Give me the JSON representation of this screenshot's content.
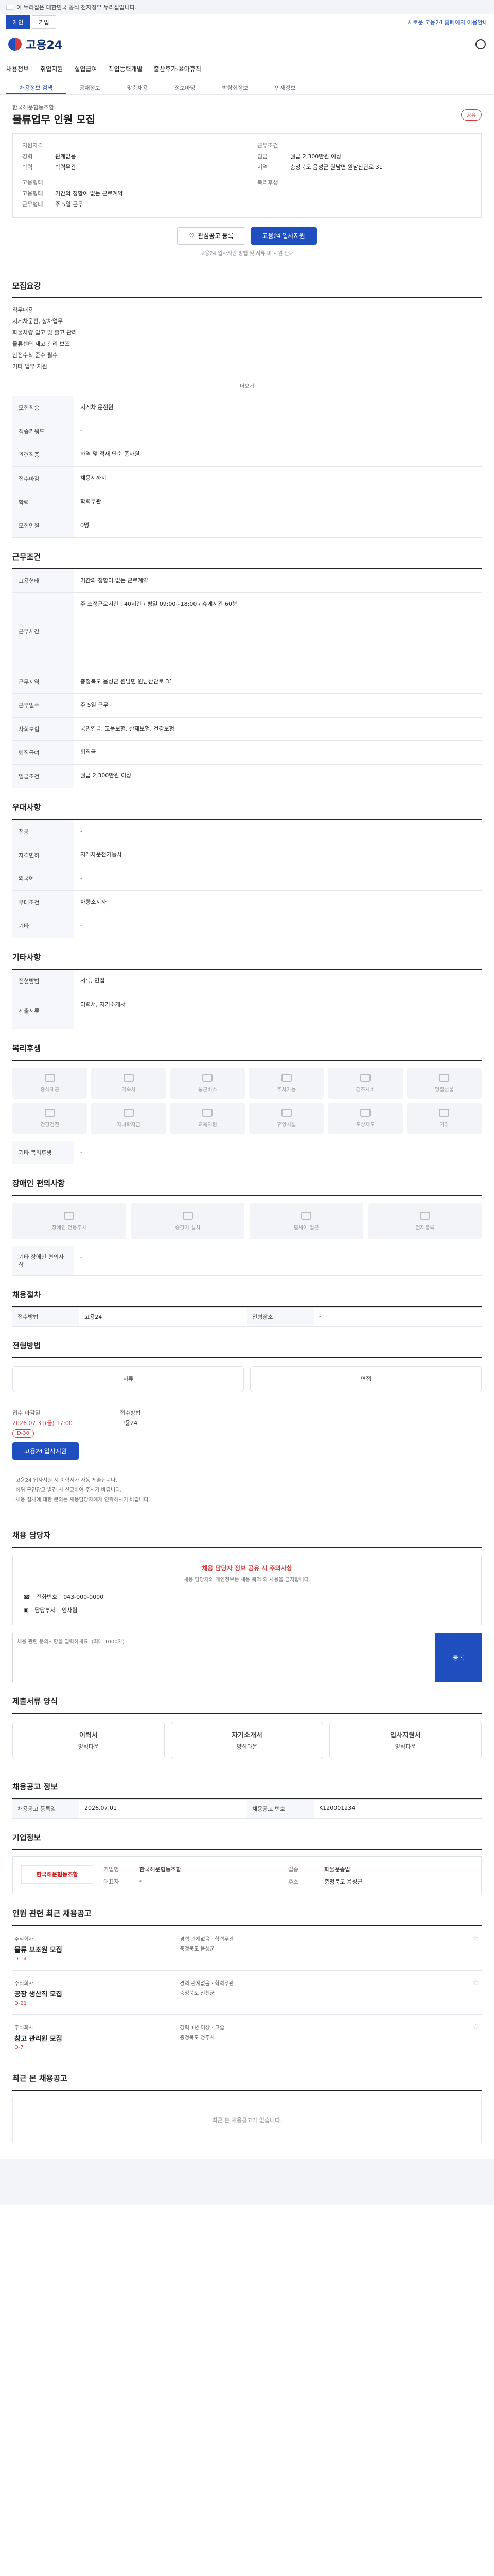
{
  "banner": {
    "text": "이 누리집은 대한민국 공식 전자정부 누리집입니다."
  },
  "utility": {
    "tab_individual": "개인",
    "tab_company": "기업",
    "right": "새로운 고용24 홈페이지 이용안내"
  },
  "logo": {
    "text": "고용24"
  },
  "nav": [
    "채용정보",
    "취업지원",
    "실업급여",
    "직업능력개발",
    "출산휴가·육아휴직"
  ],
  "subnav": [
    "채용정보 검색",
    "공채정보",
    "맞춤채용",
    "정보마당",
    "박람회정보",
    "인재정보"
  ],
  "job": {
    "company": "한국해운협동조합",
    "title": "물류업무 인원 모집",
    "share": "공유",
    "summary_left_title": "지원자격",
    "summary_right_title": "근무조건",
    "left": [
      {
        "k": "경력",
        "v": "관계없음"
      },
      {
        "k": "학력",
        "v": "학력무관"
      }
    ],
    "right": [
      {
        "k": "임금",
        "v": "월급 2,300만원 이상"
      },
      {
        "k": "지역",
        "v": "충청북도 음성군 원남면 원남산단로 31"
      }
    ],
    "left2_title": "고용형태",
    "left2": [
      {
        "k": "고용형태",
        "v": "기간의 정함이 없는 근로계약"
      },
      {
        "k": "근무형태",
        "v": "주 5일 근무"
      }
    ],
    "right2_title": "복리후생",
    "btn_scrap": "관심공고 등록",
    "btn_apply": "고용24 입사지원",
    "note": "고용24 입사지원 방법 및 서류 미 지원 안내"
  },
  "recruit": {
    "title": "모집요강",
    "lines": [
      "직무내용",
      "지게차운전, 상차업무",
      "화물차량 입고 및 출고 관리",
      "물류센터 재고 관리 보조",
      "안전수칙 준수 필수",
      "기타 업무 지원"
    ],
    "more": "더보기",
    "rows": [
      {
        "k": "모집직종",
        "v": "지게차 운전원"
      },
      {
        "k": "직종키워드",
        "v": "-"
      },
      {
        "k": "관련직종",
        "v": "하역 및 적재 단순 종사원"
      },
      {
        "k": "접수마감",
        "v": "채용시까지"
      },
      {
        "k": "학력",
        "v": "학력무관"
      },
      {
        "k": "모집인원",
        "v": "0명"
      }
    ]
  },
  "conditions": {
    "title": "근무조건",
    "rows": [
      {
        "k": "고용형태",
        "v": "기간의 정함이 없는 근로계약"
      },
      {
        "k": "근무시간",
        "v": "주 소정근로시간 : 40시간 / 평일 09:00~18:00 / 휴게시간 60분"
      },
      {
        "k": "근무지역",
        "v": "충청북도 음성군 원남면 원남산단로 31"
      },
      {
        "k": "근무일수",
        "v": "주 5일 근무"
      },
      {
        "k": "사회보험",
        "v": "국민연금, 고용보험, 산재보험, 건강보험"
      },
      {
        "k": "퇴직급여",
        "v": "퇴직금"
      },
      {
        "k": "임금조건",
        "v": "월급 2,300만원 이상"
      }
    ]
  },
  "qualification": {
    "title": "우대사항",
    "rows": [
      {
        "k": "전공",
        "v": "-"
      },
      {
        "k": "자격면허",
        "v": "지게차운전기능사"
      },
      {
        "k": "외국어",
        "v": "-"
      },
      {
        "k": "우대조건",
        "v": "차량소지자"
      },
      {
        "k": "기타",
        "v": "-"
      }
    ]
  },
  "other": {
    "title": "기타사항",
    "rows": [
      {
        "k": "전형방법",
        "v": "서류, 면접"
      },
      {
        "k": "제출서류",
        "v": "이력서, 자기소개서"
      }
    ]
  },
  "benefits": {
    "title": "복리후생",
    "items": [
      "중식제공",
      "기숙사",
      "통근버스",
      "주차가능",
      "경조사비",
      "명절선물",
      "건강검진",
      "자녀학자금",
      "교육지원",
      "휴양시설",
      "포상제도",
      "기타"
    ],
    "extra_label": "기타 복리후생",
    "extra_value": "-"
  },
  "disability": {
    "title": "장애인 편의사항",
    "items": [
      "장애인 전용주차",
      "승강기 설치",
      "휠체어 접근",
      "점자블록"
    ],
    "extra_label": "기타 장애인 편의사항",
    "extra_value": "-"
  },
  "management": {
    "title": "채용절차",
    "rows": [
      {
        "k1": "접수방법",
        "v1": "고용24",
        "k2": "전형장소",
        "v2": "-"
      }
    ]
  },
  "deadline": {
    "title": "전형방법",
    "methods": [
      "서류",
      "면접"
    ],
    "receipt_label": "접수 마감일",
    "date": "2026.07.31(금) 17:00",
    "badge": "D-30",
    "method_label": "접수방법",
    "method_value": "고용24",
    "apply_btn": "고용24 입사지원",
    "bullets": [
      "· 고용24 입사지원 시 이력서가 자동 제출됩니다.",
      "· 허위 구인광고 발견 시 신고하여 주시기 바랍니다.",
      "· 채용 절차에 대한 문의는 채용담당자에게 연락하시기 바랍니다."
    ]
  },
  "contact": {
    "title": "채용 담당자",
    "warn": "채용 담당자 정보 공유 시 주의사항",
    "warn_sub": "채용 담당자의 개인정보는 채용 목적 외 사용을 금지합니다.",
    "phone_label": "전화번호",
    "phone": "043-000-0000",
    "dept_label": "담당부서",
    "dept": "인사팀",
    "inquiry_placeholder": "채용 관련 문의사항을 입력하세요. (최대 1000자)",
    "submit": "등록"
  },
  "docs": {
    "title": "제출서류 양식",
    "cards": [
      {
        "t": "이력서",
        "s": "양식다운"
      },
      {
        "t": "자기소개서",
        "s": "양식다운"
      },
      {
        "t": "입사지원서",
        "s": "양식다운"
      }
    ]
  },
  "info": {
    "title": "채용공고 정보",
    "rows": [
      {
        "k1": "채용공고 등록일",
        "v1": "2026.07.01",
        "k2": "채용공고 번호",
        "v2": "K120001234"
      }
    ]
  },
  "company": {
    "title": "기업정보",
    "logo": "한국해운협동조합",
    "fields": [
      {
        "k": "기업명",
        "v": "한국해운협동조합"
      },
      {
        "k": "업종",
        "v": "화물운송업"
      },
      {
        "k": "대표자",
        "v": "-"
      },
      {
        "k": "주소",
        "v": "충청북도 음성군"
      }
    ]
  },
  "similar": {
    "title": "인원 관련 최근 채용공고",
    "items": [
      {
        "co": "주식회사",
        "ti": "물류 보조원 모집",
        "dd": "D-14",
        "a": "경력 관계없음 · 학력무관",
        "b": "충청북도 음성군"
      },
      {
        "co": "주식회사",
        "ti": "공장 생산직 모집",
        "dd": "D-21",
        "a": "경력 관계없음 · 학력무관",
        "b": "충청북도 진천군"
      },
      {
        "co": "주식회사",
        "ti": "창고 관리원 모집",
        "dd": "D-7",
        "a": "경력 1년 이상 · 고졸",
        "b": "충청북도 청주시"
      }
    ]
  },
  "recent": {
    "title": "최근 본 채용공고",
    "empty": "최근 본 채용공고가 없습니다."
  }
}
